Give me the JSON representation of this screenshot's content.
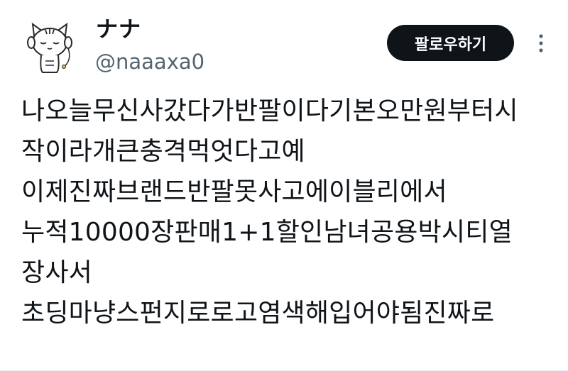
{
  "user": {
    "display_name": "ナナ",
    "handle": "@naaaxa0",
    "avatar_icon": "white-cat-avatar-icon"
  },
  "actions": {
    "follow_label": "팔로우하기",
    "more_icon": "more-vertical-icon"
  },
  "tweet": {
    "lines": [
      "나오늘무신사갔다가반팔이다기본오만원부터시",
      "작이라개큰충격먹엇다고예",
      "이제진짜브랜드반팔못사고에이블리에서",
      "누적10000장판매1+1할인남녀공용박시티열",
      "장사서",
      "초딩마냥스펀지로로고염색해입어야됨진짜로"
    ]
  },
  "colors": {
    "text": "#0f1419",
    "secondary_text": "#536471",
    "button_bg": "#0f1419",
    "button_text": "#ffffff"
  }
}
